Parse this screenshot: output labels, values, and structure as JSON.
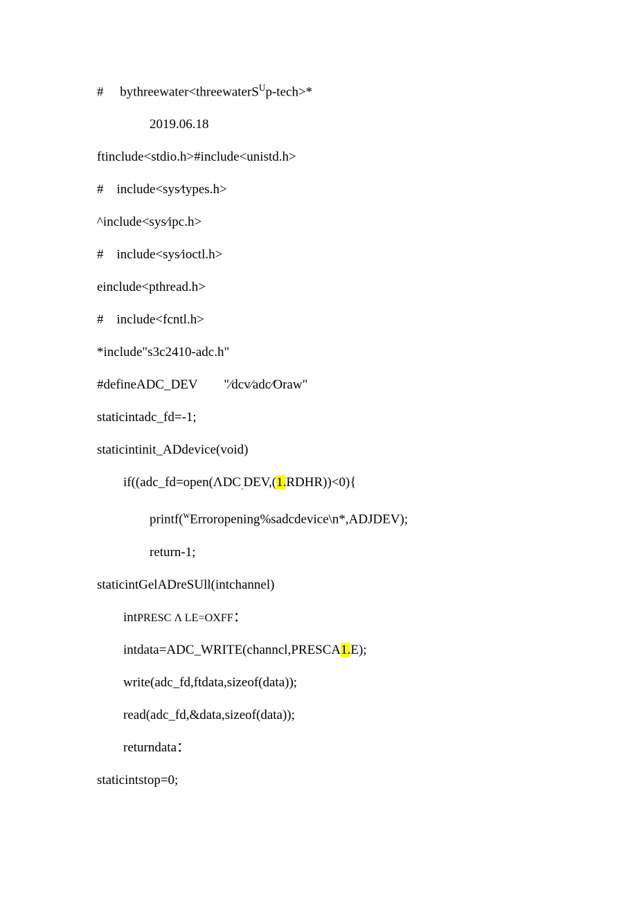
{
  "lines": [
    {
      "cls": "line",
      "parts": [
        {
          "t": "#     bythreewater<threewaterS"
        },
        {
          "t": "U",
          "sup": true
        },
        {
          "t": "p-tech>*"
        }
      ]
    },
    {
      "cls": "line indent2",
      "parts": [
        {
          "t": "2019.06.18"
        }
      ]
    },
    {
      "cls": "line",
      "parts": [
        {
          "t": "ftinclude<stdio.h>#include<unistd.h>"
        }
      ]
    },
    {
      "cls": "line",
      "parts": [
        {
          "t": "#    include<sys⁄types.h>"
        }
      ]
    },
    {
      "cls": "line",
      "parts": [
        {
          "t": "^include<sys⁄ipc.h>"
        }
      ]
    },
    {
      "cls": "line",
      "parts": [
        {
          "t": "#    include<sys⁄ioctl.h>"
        }
      ]
    },
    {
      "cls": "line",
      "parts": [
        {
          "t": "einclude<pthread.h>"
        }
      ]
    },
    {
      "cls": "line",
      "parts": [
        {
          "t": "#    include<fcntl.h>"
        }
      ]
    },
    {
      "cls": "line",
      "parts": [
        {
          "t": "*include\"s3c2410-adc.h\""
        }
      ]
    },
    {
      "cls": "line",
      "parts": [
        {
          "t": "#defineADC_DEV        \"⁄dcv⁄adc⁄Oraw\""
        }
      ]
    },
    {
      "cls": "line",
      "parts": [
        {
          "t": "staticintadc_fd=-1;"
        }
      ]
    },
    {
      "cls": "line",
      "parts": [
        {
          "t": "staticintinit_ADdevice(void)"
        }
      ]
    },
    {
      "cls": "line indent1",
      "parts": [
        {
          "t": "if((adc_fd=open(ΛDC"
        },
        {
          "t": ".",
          "sub": true
        },
        {
          "t": "DEV,("
        },
        {
          "t": "1.",
          "hl": true
        },
        {
          "t": "RDHR))<0){"
        }
      ]
    },
    {
      "cls": "line indent2",
      "parts": [
        {
          "t": "printf("
        },
        {
          "t": "w",
          "sup": true
        },
        {
          "t": "Erroropening%sadcdevice\\n*,ADJDEV);"
        }
      ]
    },
    {
      "cls": "line indent2",
      "parts": [
        {
          "t": "return-1;"
        }
      ]
    },
    {
      "cls": "line",
      "parts": [
        {
          "t": "staticintGelADreSUll(intchannel)"
        }
      ]
    },
    {
      "cls": "line indent1",
      "parts": [
        {
          "t": "int"
        },
        {
          "t": "PRESC Λ LE=OXFF",
          "small": true
        },
        {
          "t": "："
        }
      ]
    },
    {
      "cls": "line indent1",
      "parts": [
        {
          "t": "intdata=ADC_WRITE(channcl,PRESCA"
        },
        {
          "t": "1.",
          "hl": true
        },
        {
          "t": "E);"
        }
      ]
    },
    {
      "cls": "line indent1",
      "parts": [
        {
          "t": "write(adc_fd,ftdata,sizeof(data));"
        }
      ]
    },
    {
      "cls": "line indent1",
      "parts": [
        {
          "t": "read(adc_fd,&data,sizeof(data));"
        }
      ]
    },
    {
      "cls": "line indent1",
      "parts": [
        {
          "t": "returndata："
        }
      ]
    },
    {
      "cls": "line",
      "parts": [
        {
          "t": "staticintstop=0;"
        }
      ]
    }
  ]
}
